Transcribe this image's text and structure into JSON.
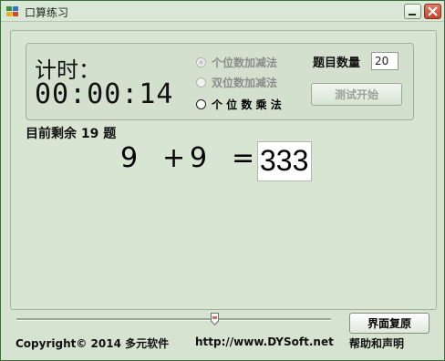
{
  "window": {
    "title": "口算练习"
  },
  "timer": {
    "label": "计时：",
    "value": "00:00:14"
  },
  "modes": [
    {
      "label": "个位数加减法",
      "state": "disabled-selected"
    },
    {
      "label": "双位数加减法",
      "state": "disabled"
    },
    {
      "label": "个 位 数 乘 法",
      "state": "enabled"
    }
  ],
  "question_count": {
    "label": "题目数量",
    "value": "20"
  },
  "test_button": {
    "label": "测试开始"
  },
  "remaining": "目前剩余 19 题",
  "question": {
    "left": "9",
    "operator": "+",
    "right": "9",
    "equals": "=",
    "answer": "333"
  },
  "reset_button": {
    "label": "界面复原"
  },
  "footer": {
    "copyright": "Copyright©  2014 多元软件",
    "url": "http://www.DYSoft.net",
    "help": "帮助和声明"
  },
  "colors": {
    "window_bg": "#d7e3d1",
    "border": "#3b6f3a",
    "disabled_text": "#8c8c8c"
  }
}
